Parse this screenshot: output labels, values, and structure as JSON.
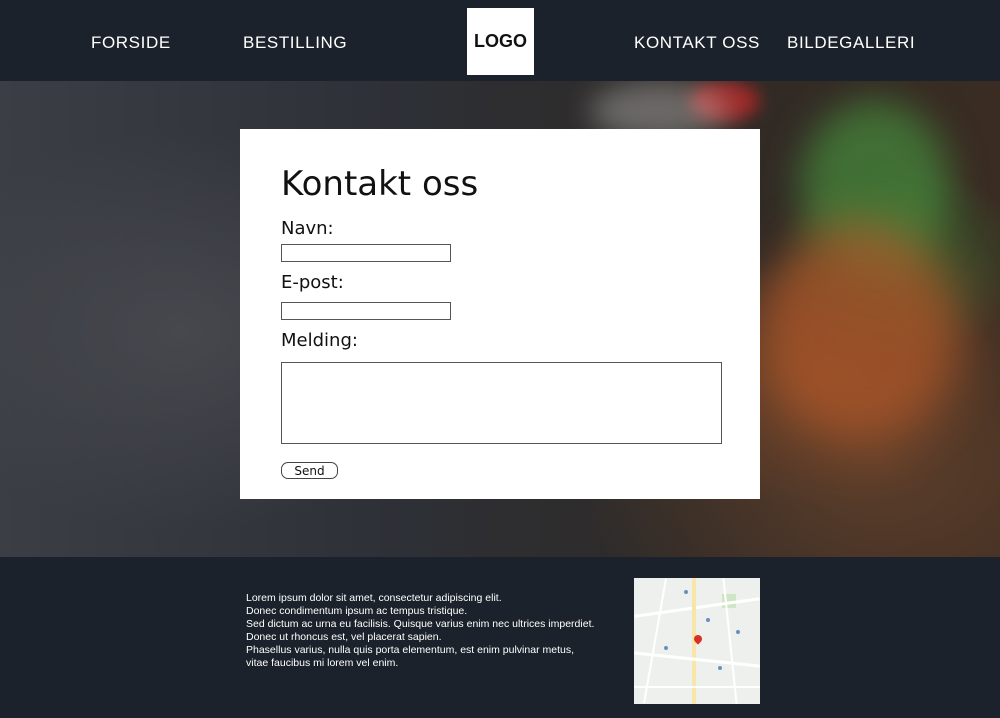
{
  "nav": {
    "items": [
      "FORSIDE",
      "BESTILLING",
      "KONTAKT OSS",
      "BILDEGALLERI"
    ],
    "logo": "LOGO"
  },
  "form": {
    "title": "Kontakt oss",
    "name_label": "Navn:",
    "email_label": "E-post:",
    "message_label": "Melding:",
    "name_value": "",
    "email_value": "",
    "message_value": "",
    "send_label": "Send"
  },
  "footer": {
    "lines": [
      "Lorem ipsum dolor sit amet, consectetur adipiscing elit.",
      "Donec condimentum ipsum ac tempus tristique.",
      "Sed dictum ac urna eu facilisis. Quisque varius enim nec ultrices imperdiet.",
      "Donec ut rhoncus est, vel placerat sapien.",
      "Phasellus varius, nulla quis porta elementum, est enim pulvinar metus,",
      "vitae faucibus mi lorem vel enim."
    ]
  },
  "colors": {
    "nav_bg": "#1c222b",
    "footer_bg": "#1c222b",
    "card_bg": "#ffffff",
    "map_pin": "#d93025"
  },
  "icons": {
    "map": "map-location-icon"
  }
}
